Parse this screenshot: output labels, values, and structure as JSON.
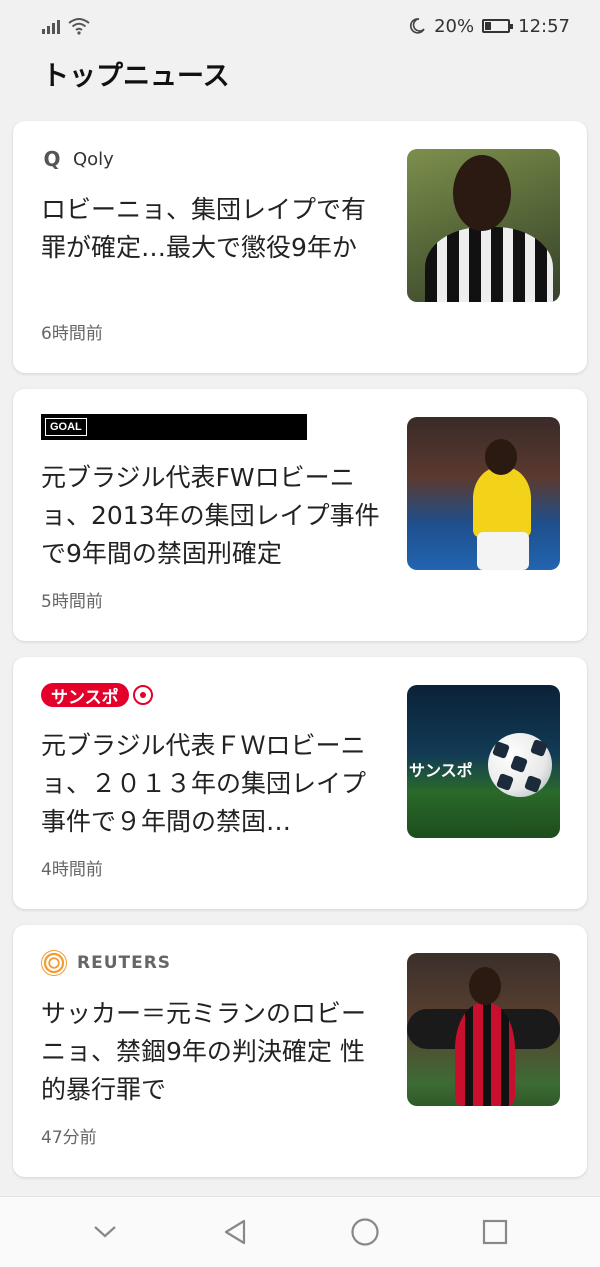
{
  "status_bar": {
    "battery_percent": "20%",
    "time": "12:57"
  },
  "page": {
    "title": "トップニュース"
  },
  "articles": [
    {
      "source": "Qoly",
      "headline": "ロビーニョ、集団レイプで有罪が確定…最大で懲役9年か",
      "time_ago": "6時間前"
    },
    {
      "source": "GOAL",
      "headline": "元ブラジル代表FWロビーニョ、2013年の集団レイプ事件で9年間の禁固刑確定",
      "time_ago": "5時間前"
    },
    {
      "source": "サンスポ",
      "headline": "元ブラジル代表ＦＷロビーニョ、２０１３年の集団レイプ事件で９年間の禁固…",
      "time_ago": "4時間前",
      "thumb_caption": "サンスポ"
    },
    {
      "source": "REUTERS",
      "headline": "サッカー＝元ミランのロビーニョ、禁錮9年の判決確定 性的暴行罪で",
      "time_ago": "47分前"
    }
  ],
  "colors": {
    "background": "#f1f1f1",
    "card": "#ffffff",
    "sanspo_red": "#e4002b",
    "reuters_orange": "#f39c33"
  },
  "icons": {
    "status": [
      "signal-icon",
      "wifi-icon",
      "moon-icon",
      "battery-icon"
    ],
    "nav": [
      "chevron-down-icon",
      "back-triangle-icon",
      "home-circle-icon",
      "recents-square-icon"
    ]
  }
}
